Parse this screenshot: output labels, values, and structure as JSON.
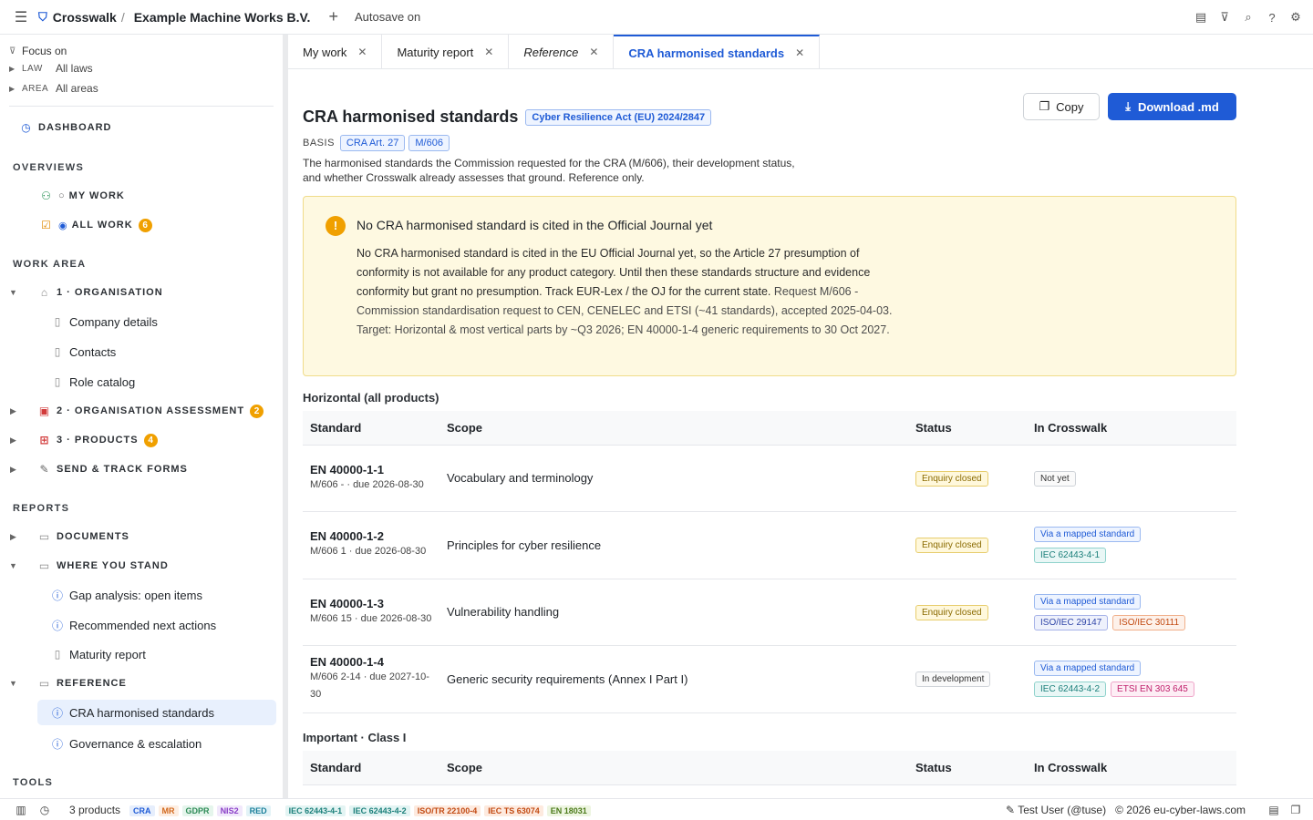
{
  "topbar": {
    "menu_icon": "hamburger-icon",
    "brand": "Crosswalk",
    "separator": "/",
    "org": "Example Machine Works B.V.",
    "autosave": "Autosave on",
    "right_icons": [
      "notes-icon",
      "filter-icon",
      "search-icon",
      "help-icon",
      "gear-icon"
    ]
  },
  "sidebar": {
    "focus_title": "Focus on",
    "focus": [
      {
        "key": "LAW",
        "value": "All laws"
      },
      {
        "key": "AREA",
        "value": "All areas"
      }
    ],
    "dashboard": "DASHBOARD",
    "overviews_head": "OVERVIEWS",
    "my_work": "MY WORK",
    "all_work": "ALL WORK",
    "all_work_badge": "6",
    "work_area_head": "WORK AREA",
    "organisation": "1 · ORGANISATION",
    "company_details": "Company details",
    "contacts": "Contacts",
    "role_catalog": "Role catalog",
    "org_assessment": "2 · ORGANISATION ASSESSMENT",
    "org_assessment_badge": "2",
    "products": "3 · PRODUCTS",
    "products_badge": "4",
    "send_track": "SEND & TRACK FORMS",
    "reports_head": "REPORTS",
    "documents": "DOCUMENTS",
    "where_you_stand": "WHERE YOU STAND",
    "gap_analysis": "Gap analysis: open items",
    "next_actions": "Recommended next actions",
    "maturity_report": "Maturity report",
    "reference": "REFERENCE",
    "cra_standards": "CRA harmonised standards",
    "governance": "Governance & escalation",
    "tools_head": "TOOLS"
  },
  "tabs": [
    {
      "label": "My work",
      "close": "✕"
    },
    {
      "label": "Maturity report",
      "close": "✕"
    },
    {
      "label": "Reference",
      "close": "✕"
    },
    {
      "label": "CRA harmonised standards",
      "close": "✕"
    }
  ],
  "main": {
    "title": "CRA harmonised standards",
    "law_chip": "Cyber Resilience Act (EU) 2024/2847",
    "basis_label": "BASIS",
    "basis_chips": [
      "CRA Art. 27",
      "M/606"
    ],
    "description": "The harmonised standards the Commission requested for the CRA (M/606), their development status, and whether Crosswalk already assesses that ground. Reference only.",
    "copy_label": "Copy",
    "download_label": "Download .md",
    "alert_title": "No CRA harmonised standard is cited in the Official Journal yet",
    "alert_body": "No CRA harmonised standard is cited in the EU Official Journal yet, so the Article 27 presumption of conformity is not available for any product category. Until then these standards structure and evidence conformity but grant no presumption. Track EUR-Lex / the OJ for the current state.",
    "alert_body_muted": "Request M/606 - Commission standardisation request to CEN, CENELEC and ETSI (~41 standards), accepted 2025-04-03. Target: Horizontal & most vertical parts by ~Q3 2026; EN 40000-1-4 generic requirements to 30 Oct 2027.",
    "section1": "Horizontal (all products)",
    "section2": "Important · Class I",
    "columns": [
      "Standard",
      "Scope",
      "Status",
      "In Crosswalk"
    ],
    "rows": [
      {
        "name": "EN 40000-1-1",
        "meta": "M/606 - · due 2026-08-30",
        "scope": "Vocabulary and terminology",
        "status": "Enquiry closed",
        "crosswalk": "Not yet",
        "mapped": []
      },
      {
        "name": "EN 40000-1-2",
        "meta": "M/606 1 · due 2026-08-30",
        "scope": "Principles for cyber resilience",
        "status": "Enquiry closed",
        "crosswalk": "Via a mapped standard",
        "mapped": [
          "IEC 62443-4-1"
        ]
      },
      {
        "name": "EN 40000-1-3",
        "meta": "M/606 15 · due 2026-08-30",
        "scope": "Vulnerability handling",
        "status": "Enquiry closed",
        "crosswalk": "Via a mapped standard",
        "mapped": [
          "ISO/IEC 29147",
          "ISO/IEC 30111"
        ]
      },
      {
        "name": "EN 40000-1-4",
        "meta": "M/606 2-14 · due 2027-10-30",
        "scope": "Generic security requirements (Annex I Part I)",
        "status": "In development",
        "crosswalk": "Via a mapped standard",
        "mapped": [
          "IEC 62443-4-2",
          "ETSI EN 303 645"
        ]
      }
    ]
  },
  "footer": {
    "products": "3 products",
    "law_tags": [
      {
        "label": "CRA",
        "color": "#1f5bd6",
        "bg": "#e6eefc"
      },
      {
        "label": "MR",
        "color": "#d2691e",
        "bg": "#fdeee2"
      },
      {
        "label": "GDPR",
        "color": "#2e8b57",
        "bg": "#e5f5ec"
      },
      {
        "label": "NIS2",
        "color": "#8a3fc7",
        "bg": "#f1e8fb"
      },
      {
        "label": "RED",
        "color": "#1a7f9a",
        "bg": "#e3f3f7"
      }
    ],
    "std_tags": [
      {
        "label": "IEC 62443-4-1",
        "color": "#1a7f7a",
        "bg": "#e3f4f3"
      },
      {
        "label": "IEC 62443-4-2",
        "color": "#1a7f7a",
        "bg": "#e3f4f3"
      },
      {
        "label": "ISO/TR 22100-4",
        "color": "#c24a12",
        "bg": "#fdeadf"
      },
      {
        "label": "IEC TS 63074",
        "color": "#c24a12",
        "bg": "#fdeadf"
      },
      {
        "label": "EN 18031",
        "color": "#4b7a1a",
        "bg": "#edf5e1"
      }
    ],
    "user": "Test User (@tuse)",
    "copyright": "© 2026 eu-cyber-laws.com"
  }
}
